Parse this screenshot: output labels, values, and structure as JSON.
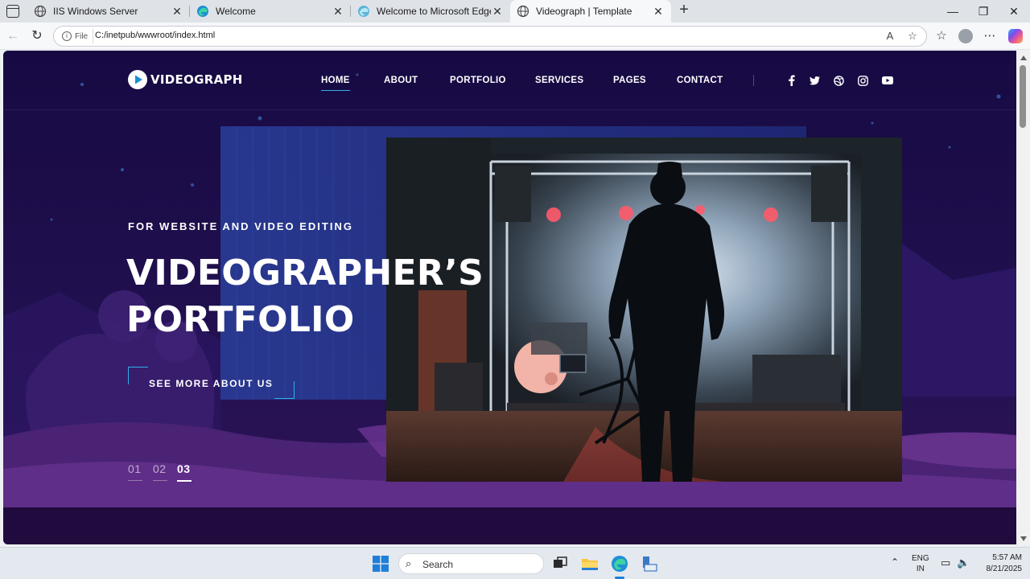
{
  "browser": {
    "tabs": [
      {
        "title": "IIS Windows Server",
        "icon": "globe-icon",
        "active": false
      },
      {
        "title": "Welcome",
        "icon": "edge-icon",
        "active": false
      },
      {
        "title": "Welcome to Microsoft Edge",
        "icon": "edge-icon",
        "active": false
      },
      {
        "title": "Videograph | Template",
        "icon": "globe-icon",
        "active": true
      }
    ],
    "site_info_label": "File",
    "url": "C:/inetpub/wwwroot/index.html"
  },
  "site": {
    "logo_text": "VIDEOGRAPH",
    "nav": [
      {
        "label": "HOME",
        "active": true
      },
      {
        "label": "ABOUT",
        "active": false
      },
      {
        "label": "PORTFOLIO",
        "active": false
      },
      {
        "label": "SERVICES",
        "active": false
      },
      {
        "label": "PAGES",
        "active": false
      },
      {
        "label": "CONTACT",
        "active": false
      }
    ],
    "social": [
      "facebook-icon",
      "twitter-icon",
      "dribbble-icon",
      "instagram-icon",
      "youtube-icon"
    ],
    "hero": {
      "kicker": "FOR WEBSITE AND VIDEO EDITING",
      "title_line1": "VIDEOGRAPHER’S",
      "title_line2": "PORTFOLIO",
      "cta_label": "SEE MORE ABOUT US",
      "slides": [
        "01",
        "02",
        "03"
      ],
      "current_slide": "03"
    },
    "accent_color": "#2fb0e8"
  },
  "taskbar": {
    "search_placeholder": "Search",
    "language": "ENG",
    "region": "IN",
    "time": "5:57 AM",
    "date": "8/21/2025"
  }
}
